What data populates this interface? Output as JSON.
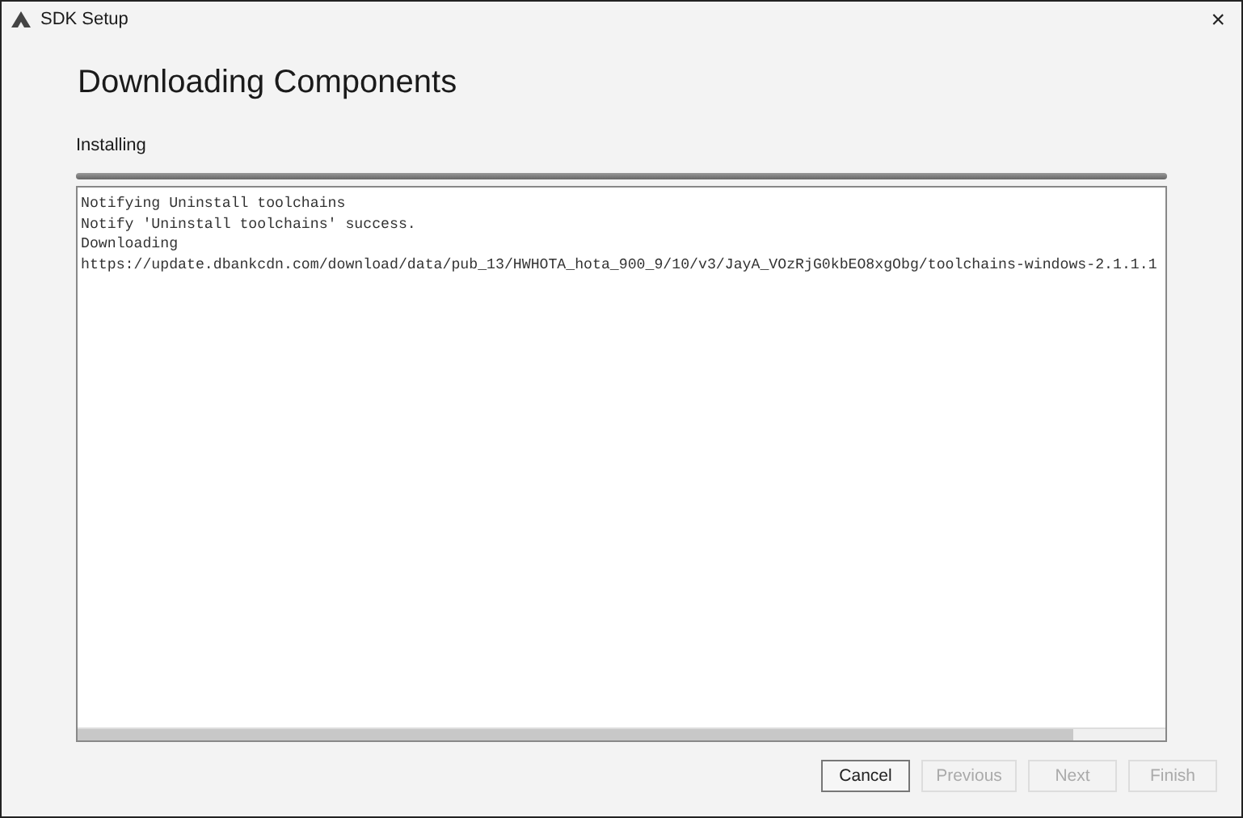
{
  "window": {
    "title": "SDK Setup",
    "close": "×"
  },
  "heading": "Downloading Components",
  "status": "Installing",
  "progress": {
    "level": 1
  },
  "log": [
    "Notifying Uninstall toolchains",
    "Notify 'Uninstall toolchains' success.",
    "Downloading",
    "https://update.dbankcdn.com/download/data/pub_13/HWHOTA_hota_900_9/10/v3/JayA_VOzRjG0kbEO8xgObg/toolchains-windows-2.1.1.1"
  ],
  "buttons": [
    {
      "label": "Cancel",
      "disabled": false
    },
    {
      "label": "Previous",
      "disabled": true
    },
    {
      "label": "Next",
      "disabled": true
    },
    {
      "label": "Finish",
      "disabled": true
    }
  ]
}
